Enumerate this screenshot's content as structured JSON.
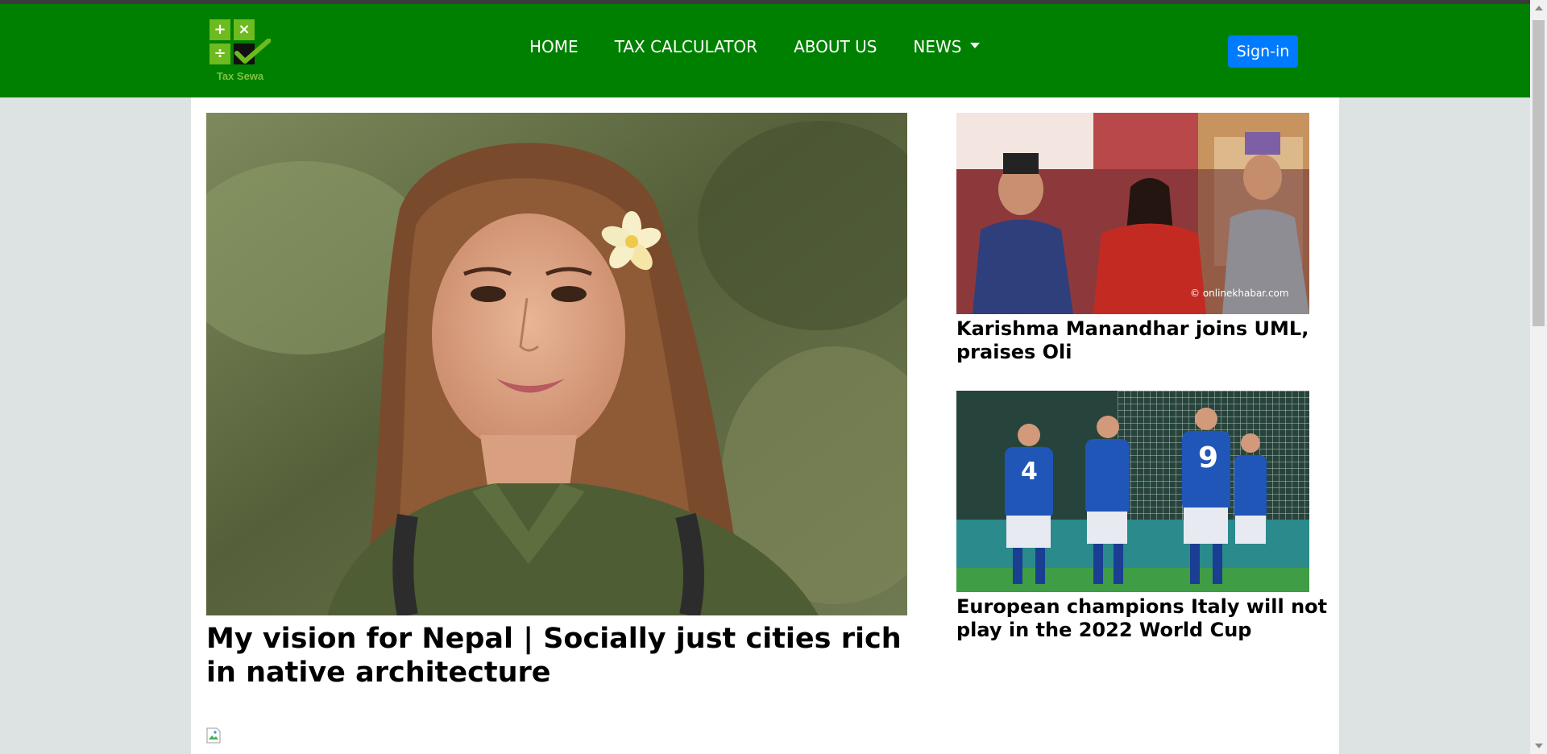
{
  "brand": {
    "name": "Tax Sewa",
    "logo_symbols": [
      "+",
      "×",
      "÷"
    ],
    "accent": "#008000",
    "logo_green": "#6dbb1f"
  },
  "nav": {
    "items": [
      {
        "label": "HOME"
      },
      {
        "label": "TAX CALCULATOR"
      },
      {
        "label": "ABOUT US"
      },
      {
        "label": "NEWS"
      }
    ],
    "signin_label": "Sign-in",
    "signin_color": "#007bff"
  },
  "featured": {
    "title": "My vision for Nepal | Socially just cities rich in native architecture"
  },
  "side_news": [
    {
      "title": "Karishma Manandhar joins UML, praises Oli",
      "image_watermark": "© onlinekhabar.com"
    },
    {
      "title": "European champions Italy will not play in the 2022 World Cup",
      "jersey_numbers": [
        "4",
        "9"
      ]
    }
  ]
}
